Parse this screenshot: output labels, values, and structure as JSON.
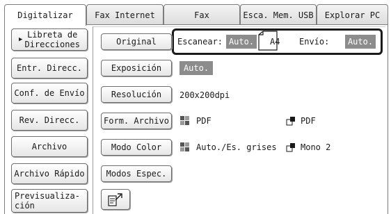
{
  "tabs": [
    "Digitalizar",
    "Fax Internet",
    "Fax",
    "Esca. Mem. USB",
    "Explorar PC"
  ],
  "sidebar": {
    "libreta": "Libreta de\nDirecciones",
    "entr": "Entr. Direcc.",
    "conf": "Conf. de Envío",
    "rev": "Rev. Direcc.",
    "archivo": "Archivo",
    "archivo_rapido": "Archivo Rápido",
    "previsualizacion": "Previsualiza-\nción"
  },
  "status": {
    "scan_label": "Escanear:",
    "scan_value": "Auto.",
    "paper": "A4",
    "send_label": "Envío:",
    "send_value": "Auto."
  },
  "buttons": {
    "original": "Original",
    "exposicion": "Exposición",
    "resolucion": "Resolución",
    "form_archivo": "Form. Archivo",
    "modo_color": "Modo Color",
    "modos_espec": "Modos Espec."
  },
  "values": {
    "exposicion": "Auto.",
    "resolucion": "200x200dpi",
    "format_left": "PDF",
    "format_right": "PDF",
    "color_left": "Auto./Es. grises",
    "color_right": "Mono 2"
  },
  "icons": {
    "grid_color": "color-grid-icon",
    "mono": "mono-doc-icon",
    "preview": "preview-document-icon"
  }
}
